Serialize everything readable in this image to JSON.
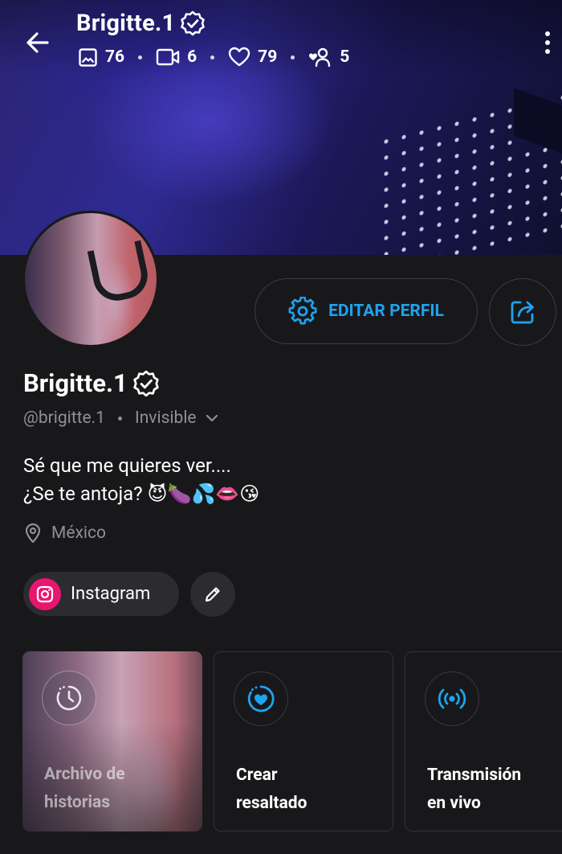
{
  "header": {
    "name": "Brigitte.1",
    "stats": {
      "photos": "76",
      "videos": "6",
      "likes": "79",
      "followers": "5"
    }
  },
  "profile": {
    "name": "Brigitte.1",
    "handle": "@brigitte.1",
    "status": "Invisible",
    "bio_line1": "Sé que me quieres ver....",
    "bio_line2": "¿Se te antoja? 😈🍆💦👄😘",
    "location": "México"
  },
  "actions": {
    "edit_profile": "EDITAR PERFIL"
  },
  "social": {
    "instagram": "Instagram"
  },
  "cards": {
    "archive_line1": "Archivo de",
    "archive_line2": "historias",
    "highlight_line1": "Crear",
    "highlight_line2": "resaltado",
    "live_line1": "Transmisión",
    "live_line2": "en vivo"
  },
  "colors": {
    "accent": "#1fa3f0",
    "background": "#18181a",
    "instagram": "#e8166e",
    "muted_text": "#8f8f98"
  },
  "icons": {
    "back": "arrow-left-icon",
    "verified": "verified-badge-icon",
    "photos": "image-icon",
    "videos": "video-camera-icon",
    "likes": "heart-icon",
    "followers": "user-heart-icon",
    "more": "more-vertical-icon",
    "settings": "gear-icon",
    "share": "share-icon",
    "location": "location-pin-icon",
    "instagram": "instagram-icon",
    "edit": "pencil-icon",
    "archive": "clock-history-icon",
    "highlight": "heart-circle-icon",
    "live": "broadcast-icon"
  }
}
